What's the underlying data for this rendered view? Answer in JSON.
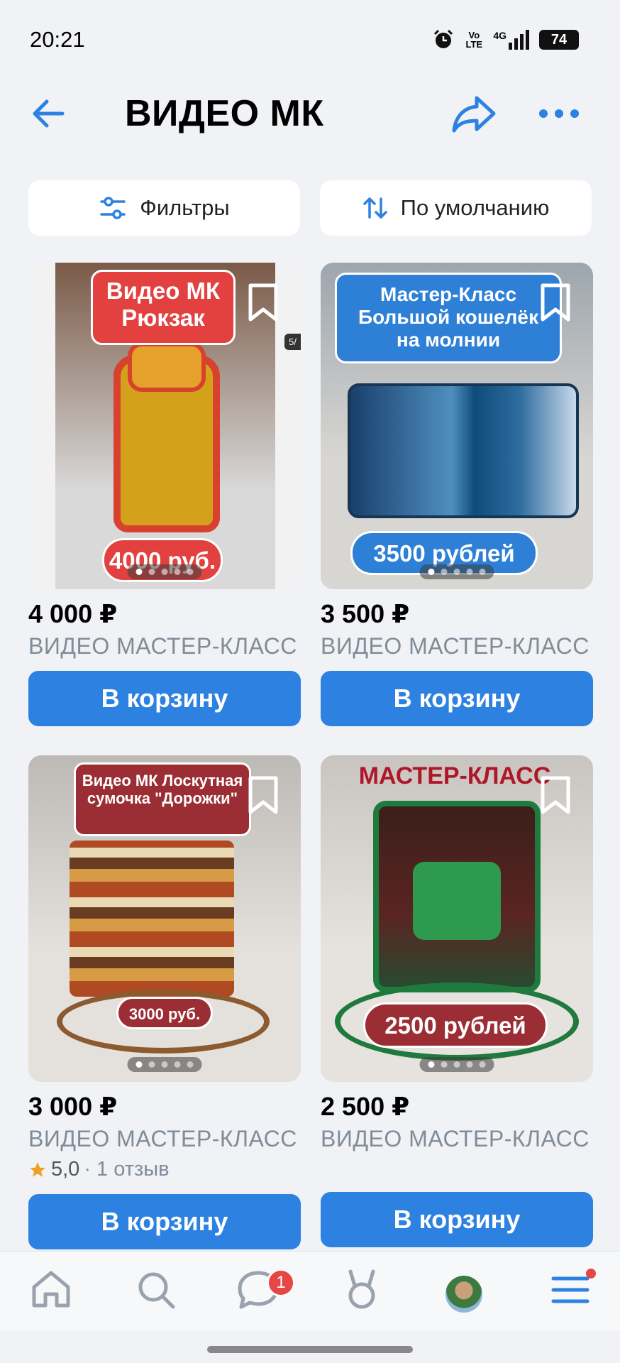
{
  "status": {
    "time": "20:21",
    "volte": "Vo LTE",
    "network": "4G",
    "battery": "74"
  },
  "header": {
    "title": "ВИДЕО МК"
  },
  "toolbar": {
    "filters_label": "Фильтры",
    "sort_label": "По умолчанию"
  },
  "products": [
    {
      "price": "4 000 ₽",
      "name": "ВИДЕО МАСТЕР-КЛАСС",
      "button": "В корзину",
      "photo_title": "Видео МК Рюкзак",
      "photo_price": "4000 руб.",
      "photo_counter": "5/",
      "colors": {
        "label": "#e2413f",
        "bg": "#6b4a3a"
      }
    },
    {
      "price": "3 500 ₽",
      "name": "ВИДЕО МАСТЕР-КЛАСС",
      "button": "В корзину",
      "photo_title": "Мастер-Класс Большой кошелёк на молнии",
      "photo_price": "3500 рублей",
      "colors": {
        "label": "#2e7fd6",
        "bg": "#c9c7c4"
      }
    },
    {
      "price": "3 000 ₽",
      "name": "ВИДЕО МАСТЕР-КЛАСС",
      "button": "В корзину",
      "photo_title": "Видео МК Лоскутная сумочка \"Дорожки\"",
      "photo_price": "3000 руб.",
      "rating_score": "5,0",
      "rating_text": "· 1 отзыв",
      "colors": {
        "label": "#9a2e34",
        "bg": "#d9d5cf"
      }
    },
    {
      "price": "2 500 ₽",
      "name": "ВИДЕО МАСТЕР-КЛАСС",
      "button": "В корзину",
      "photo_title": "МАСТЕР-КЛАСС",
      "photo_price": "2500 рублей",
      "colors": {
        "label": "#9a2e34",
        "bg": "#dcd9d4"
      }
    }
  ],
  "tabbar": {
    "messages_badge": "1"
  },
  "icons": [
    "back-arrow-icon",
    "share-icon",
    "more-icon",
    "filters-icon",
    "sort-icon",
    "bookmark-icon",
    "home-icon",
    "search-icon",
    "messages-icon",
    "clips-icon",
    "profile-avatar",
    "menu-icon"
  ],
  "colors": {
    "accent": "#2d81e0",
    "background": "#f0f2f5",
    "muted_text": "#818c99",
    "badge": "#e64646"
  }
}
